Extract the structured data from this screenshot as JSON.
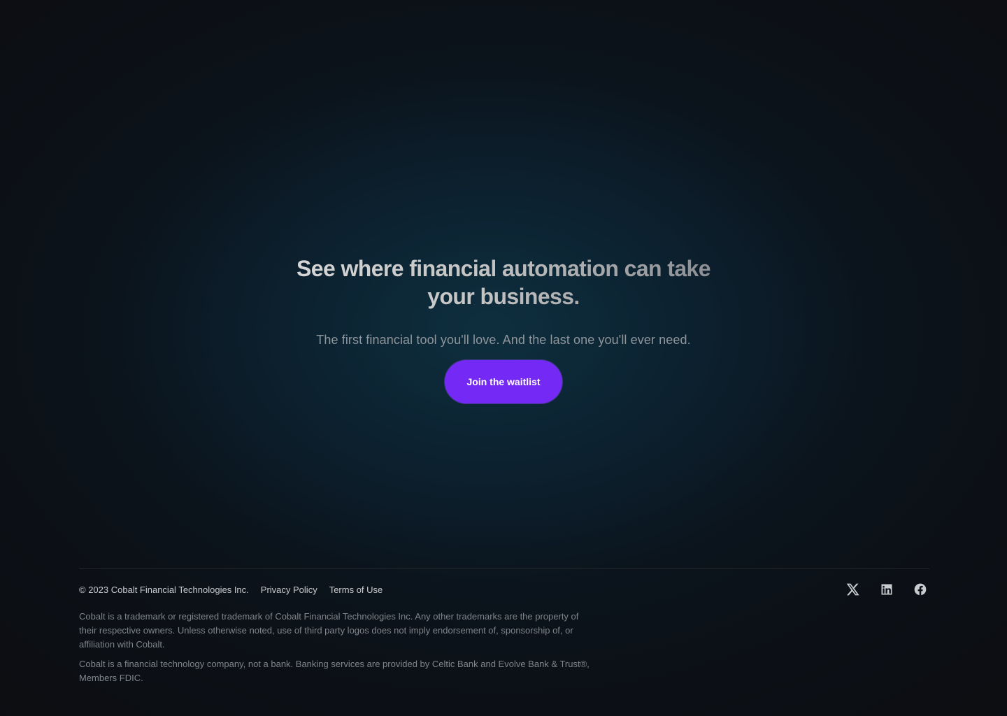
{
  "hero": {
    "headline": "See where financial automation can take your business.",
    "subheadline": "The first financial tool you'll love. And the last one you'll ever need.",
    "cta_label": "Join the waitlist"
  },
  "footer": {
    "copyright": "© 2023 Cobalt Financial Technologies Inc.",
    "links": [
      {
        "label": "Privacy Policy"
      },
      {
        "label": "Terms of Use"
      }
    ],
    "social_icons": [
      "x-icon",
      "linkedin-icon",
      "facebook-icon"
    ],
    "legal": [
      "Cobalt is a trademark or registered trademark of Cobalt Financial Technologies Inc. Any other trademarks are the property of their respective owners. Unless otherwise noted, use of third party logos does not imply endorsement of, sponsorship of, or affiliation with Cobalt.",
      "Cobalt is a financial technology company, not a bank. Banking services are provided by Celtic Bank and Evolve Bank & Trust®, Members FDIC."
    ]
  },
  "colors": {
    "background": "#0c0d11",
    "accent": "#7429f5",
    "glow": "#0e3040"
  }
}
